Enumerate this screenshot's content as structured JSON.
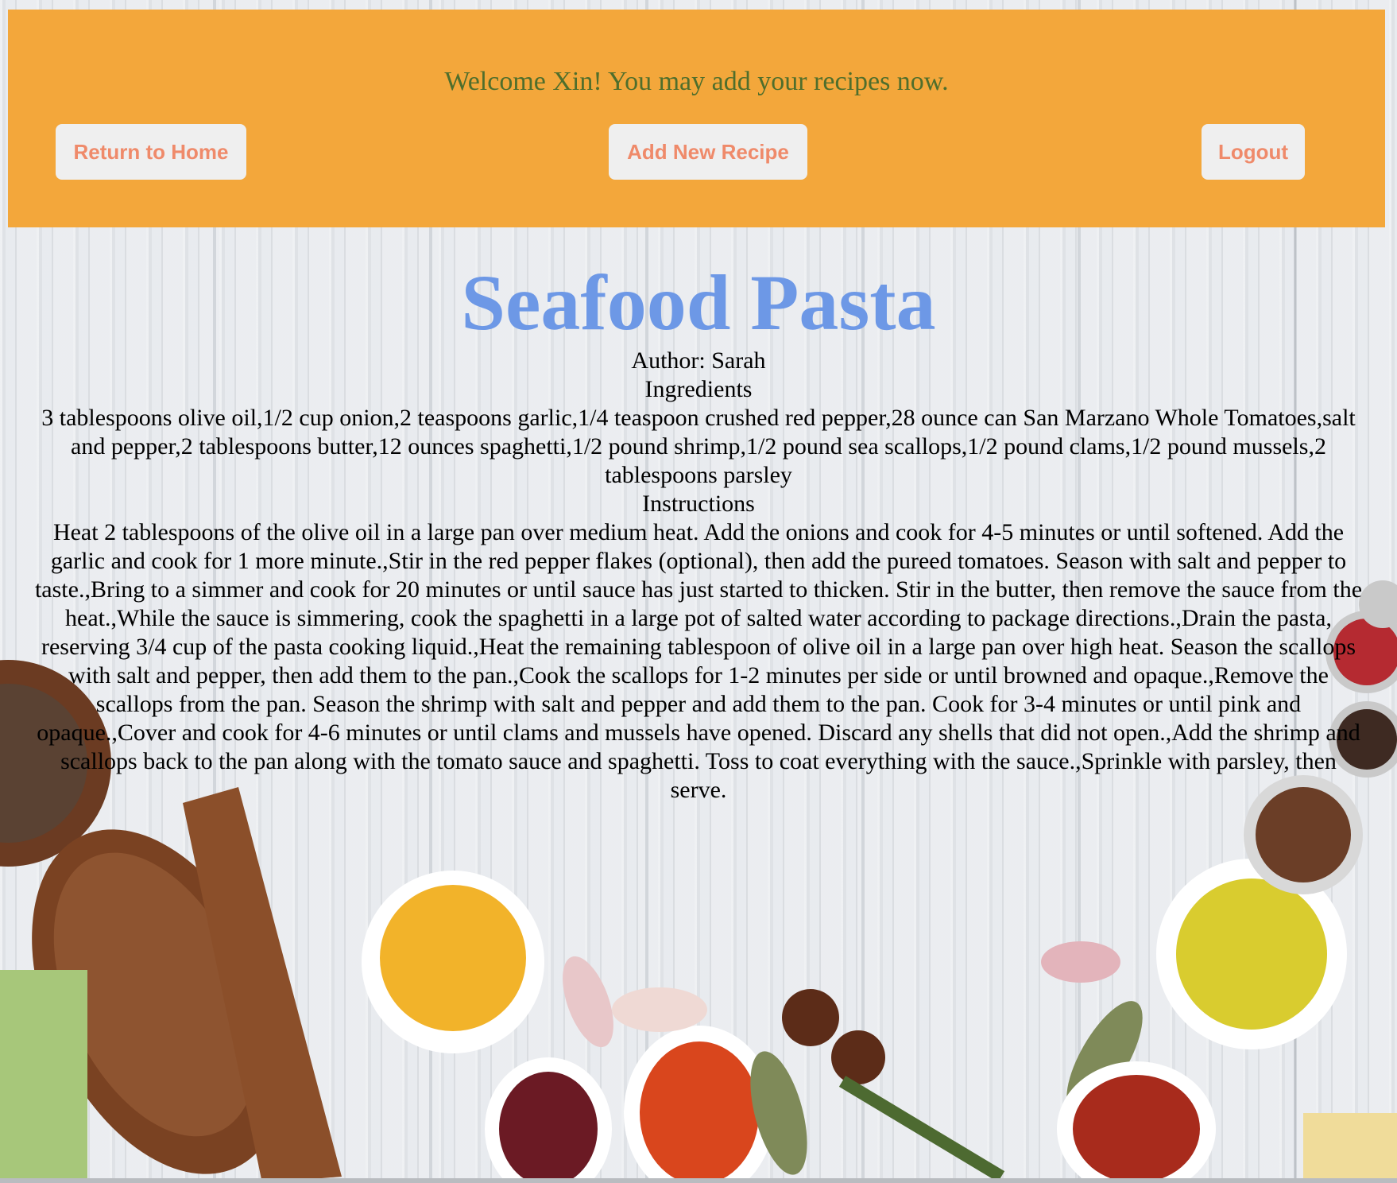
{
  "header": {
    "welcome": "Welcome Xin! You may add your recipes now.",
    "buttons": {
      "home": "Return to Home",
      "add": "Add New Recipe",
      "logout": "Logout"
    }
  },
  "recipe": {
    "title": "Seafood Pasta",
    "author": "Author: Sarah",
    "ingredients_heading": "Ingredients",
    "ingredients": "3 tablespoons olive oil,1/2 cup onion,2 teaspoons garlic,1/4 teaspoon crushed red pepper,28 ounce can San Marzano Whole Tomatoes,salt and pepper,2 tablespoons butter,12 ounces spaghetti,1/2 pound shrimp,1/2 pound sea scallops,1/2 pound clams,1/2 pound mussels,2 tablespoons parsley",
    "instructions_heading": "Instructions",
    "instructions": "Heat 2 tablespoons of the olive oil in a large pan over medium heat. Add the onions and cook for 4-5 minutes or until softened. Add the garlic and cook for 1 more minute.,Stir in the red pepper flakes (optional), then add the pureed tomatoes. Season with salt and pepper to taste.,Bring to a simmer and cook for 20 minutes or until sauce has just started to thicken. Stir in the butter, then remove the sauce from the heat.,While the sauce is simmering, cook the spaghetti in a large pot of salted water according to package directions.,Drain the pasta, reserving 3/4 cup of the pasta cooking liquid.,Heat the remaining tablespoon of olive oil in a large pan over high heat. Season the scallops with salt and pepper, then add them to the pan.,Cook the scallops for 1-2 minutes per side or until browned and opaque.,Remove the scallops from the pan. Season the shrimp with salt and pepper and add them to the pan. Cook for 3-4 minutes or until pink and opaque.,Cover and cook for 4-6 minutes or until clams and mussels have opened. Discard any shells that did not open.,Add the shrimp and scallops back to the pan along with the tomato sauce and spaghetti. Toss to coat everything with the sauce.,Sprinkle with parsley, then serve."
  },
  "colors": {
    "header_bg": "#f3a73b",
    "welcome_text": "#4f6e2c",
    "button_text": "#ef8a6a",
    "button_bg": "#efefef",
    "title": "#6d98e6"
  }
}
